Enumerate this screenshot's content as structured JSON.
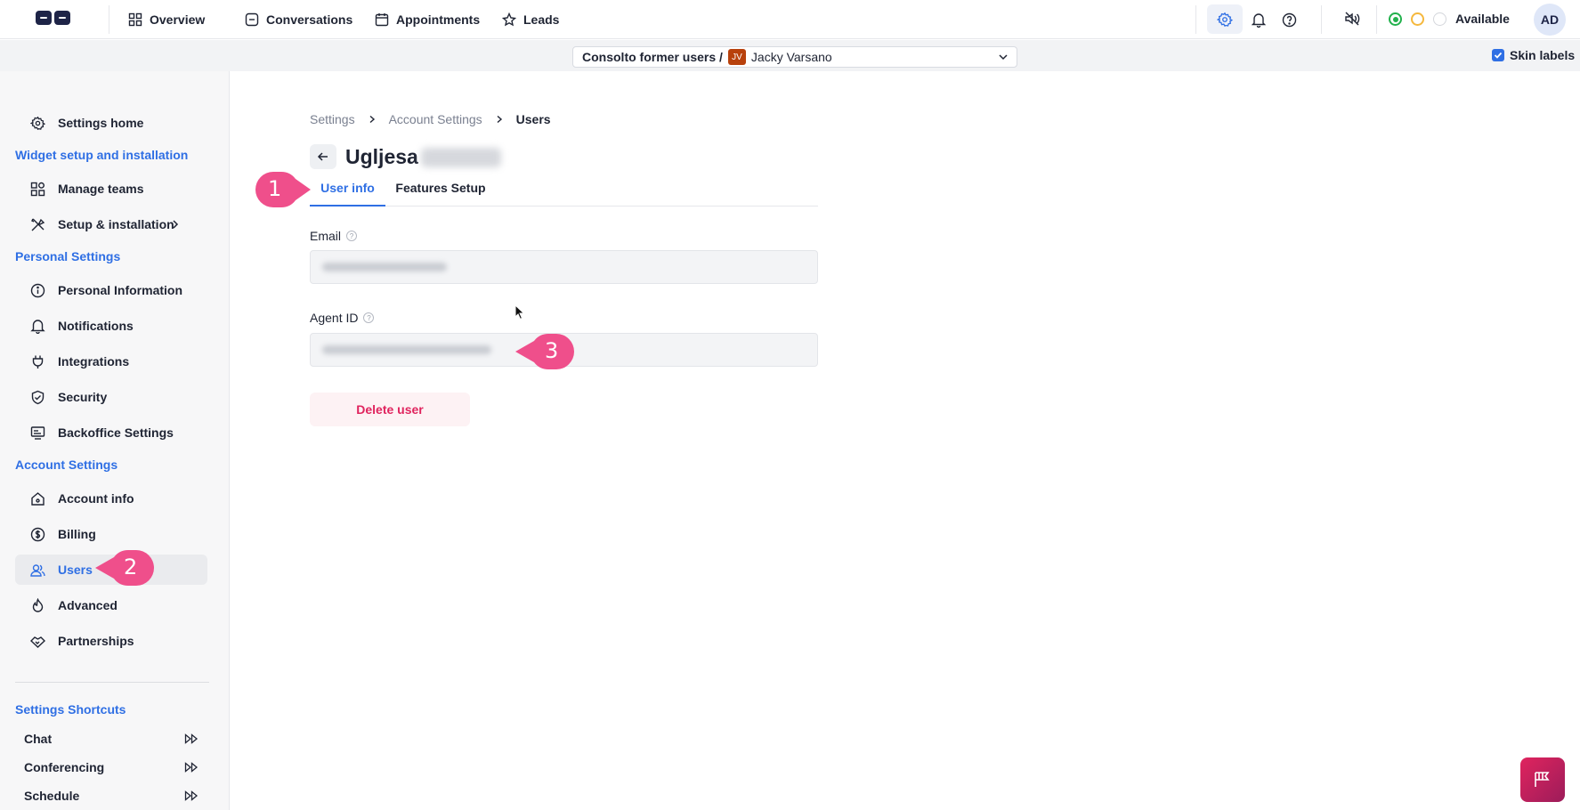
{
  "nav": {
    "items": [
      {
        "label": "Overview",
        "icon": "grid-icon"
      },
      {
        "label": "Conversations",
        "icon": "chat-icon"
      },
      {
        "label": "Appointments",
        "icon": "calendar-icon"
      },
      {
        "label": "Leads",
        "icon": "star-icon"
      }
    ],
    "status_label": "Available",
    "avatar_initials": "AD",
    "status_colors": [
      "#22b14c",
      "#f5b83d",
      "#d4d6db"
    ]
  },
  "subbar": {
    "account": "Consolto former users /",
    "user_initials": "JV",
    "user_name": "Jacky Varsano",
    "skin_labels": "Skin labels"
  },
  "sidebar": {
    "settings_home": "Settings home",
    "widget_header": "Widget setup and installation",
    "manage_teams": "Manage teams",
    "setup_installation": "Setup & installation",
    "personal_header": "Personal Settings",
    "personal_information": "Personal Information",
    "notifications": "Notifications",
    "integrations": "Integrations",
    "security": "Security",
    "backoffice_settings": "Backoffice Settings",
    "account_header": "Account Settings",
    "account_info": "Account info",
    "billing": "Billing",
    "users": "Users",
    "advanced": "Advanced",
    "partnerships": "Partnerships",
    "shortcuts_header": "Settings Shortcuts",
    "shortcuts": [
      "Chat",
      "Conferencing",
      "Schedule"
    ]
  },
  "main": {
    "breadcrumb": [
      "Settings",
      "Account Settings",
      "Users"
    ],
    "title": "Ugljesa",
    "tabs": [
      "User info",
      "Features Setup"
    ],
    "email_label": "Email",
    "agent_id_label": "Agent ID",
    "delete_label": "Delete user"
  },
  "annotations": [
    "1",
    "2",
    "3"
  ],
  "colors": {
    "accent": "#2f6fe4",
    "danger": "#e0245e",
    "marker": "#ef4f8b",
    "brand": "#1e2447"
  }
}
